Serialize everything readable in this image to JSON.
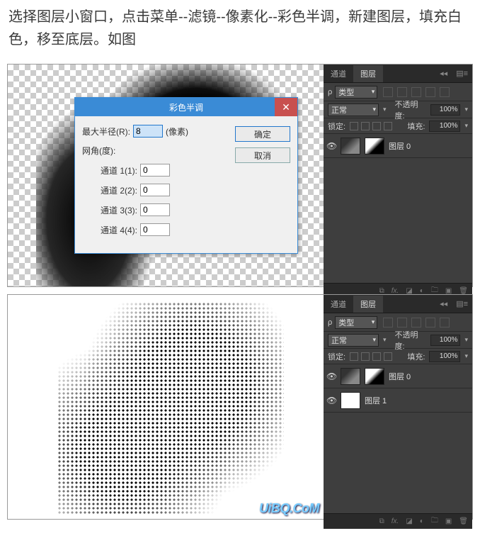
{
  "instruction": "选择图层小窗口，点击菜单--滤镜--像素化--彩色半调，新建图层，填充白色，移至底层。如图",
  "dialog": {
    "title": "彩色半调",
    "maxRadiusLabel": "最大半径(R):",
    "maxRadiusValue": "8",
    "pixelUnit": "(像素)",
    "gridAngleLabel": "网角(度):",
    "channel1Label": "通道 1(1):",
    "channel2Label": "通道 2(2):",
    "channel3Label": "通道 3(3):",
    "channel4Label": "通道 4(4):",
    "channel1": "0",
    "channel2": "0",
    "channel3": "0",
    "channel4": "0",
    "ok": "确定",
    "cancel": "取消"
  },
  "panel": {
    "tabs": {
      "channels": "通道",
      "layers": "图层"
    },
    "filterKind": "类型",
    "blendMode": "正常",
    "opacityLabel": "不透明度:",
    "opacityValue": "100%",
    "lockLabel": "锁定:",
    "fillLabel": "填充:",
    "fillValue": "100%",
    "layer0": "图层 0",
    "layer1": "图层 1",
    "menuGlyph": "▤≡",
    "collapseGlyph": "◂◂"
  },
  "watermark": "UiBQ.CoM",
  "icons": {
    "search": "ρ",
    "fx": "fx.",
    "mask": "◪",
    "adjust": "◐",
    "folder": "🗀",
    "new": "▣",
    "trash": "🗑",
    "link": "⧉"
  }
}
